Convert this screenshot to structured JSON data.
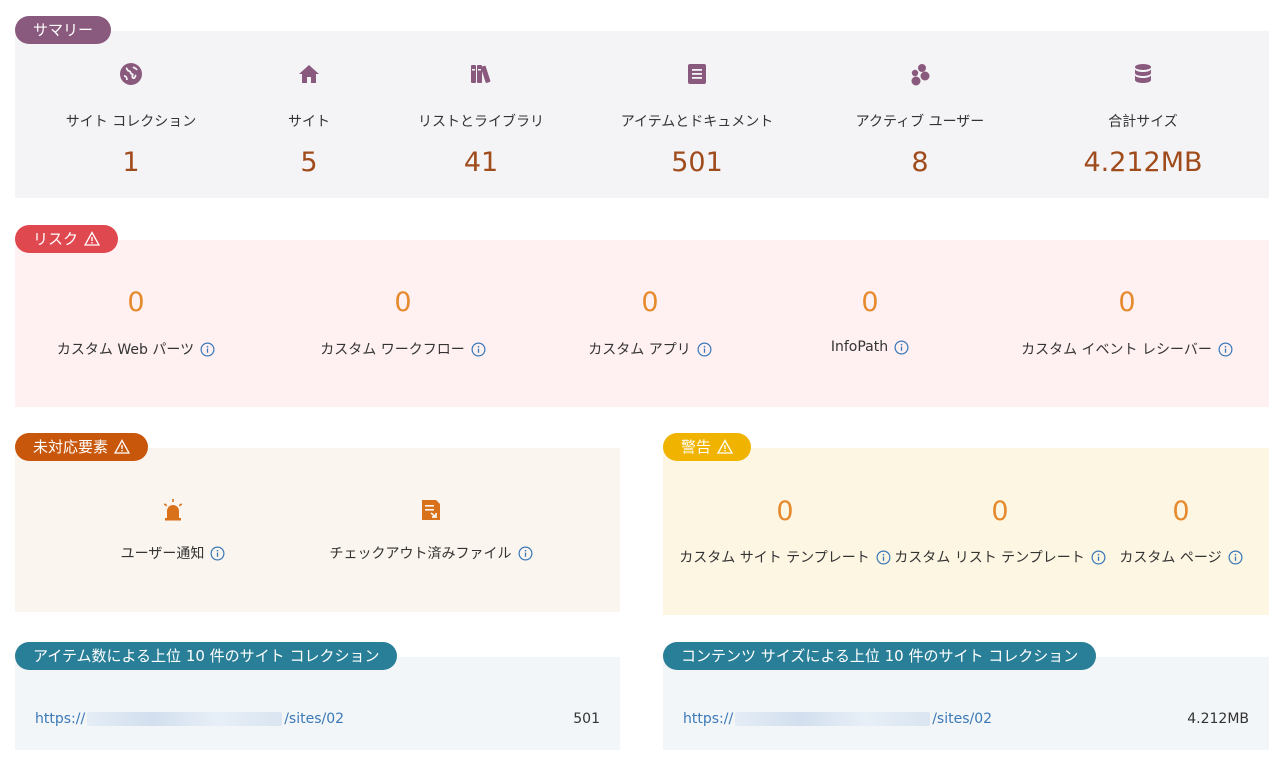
{
  "summary": {
    "tag": "サマリー",
    "items": [
      {
        "icon": "globe-icon",
        "label": "サイト コレクション",
        "value": "1"
      },
      {
        "icon": "home-icon",
        "label": "サイト",
        "value": "5"
      },
      {
        "icon": "library-books-icon",
        "label": "リストとライブラリ",
        "value": "41"
      },
      {
        "icon": "document-icon",
        "label": "アイテムとドキュメント",
        "value": "501"
      },
      {
        "icon": "users-icon",
        "label": "アクティブ ユーザー",
        "value": "8"
      },
      {
        "icon": "database-icon",
        "label": "合計サイズ",
        "value": "4.212MB"
      }
    ]
  },
  "risk": {
    "tag": "リスク",
    "items": [
      {
        "label": "カスタム Web パーツ",
        "value": "0"
      },
      {
        "label": "カスタム ワークフロー",
        "value": "0"
      },
      {
        "label": "カスタム アプリ",
        "value": "0"
      },
      {
        "label": "InfoPath",
        "value": "0"
      },
      {
        "label": "カスタム イベント レシーバー",
        "value": "0"
      }
    ]
  },
  "unsupported": {
    "tag": "未対応要素",
    "items": [
      {
        "icon": "alarm-icon",
        "label": "ユーザー通知"
      },
      {
        "icon": "checkout-file-icon",
        "label": "チェックアウト済みファイル"
      }
    ]
  },
  "warning": {
    "tag": "警告",
    "items": [
      {
        "label": "カスタム サイト テンプレート",
        "value": "0"
      },
      {
        "label": "カスタム リスト テンプレート",
        "value": "0"
      },
      {
        "label": "カスタム ページ",
        "value": "0"
      }
    ]
  },
  "top_items": {
    "tag": "アイテム数による上位 10 件のサイト コレクション",
    "url_prefix": "https://",
    "url_suffix": "/sites/02",
    "value": "501"
  },
  "top_size": {
    "tag": "コンテンツ サイズによる上位 10 件のサイト コレクション",
    "url_prefix": "https://",
    "url_suffix": "/sites/02",
    "value": "4.212MB"
  },
  "colors": {
    "summary_accent": "#8a5a7e",
    "risk_accent": "#e04850",
    "unsupported_accent": "#c8570c",
    "warning_accent": "#f0b400",
    "top_accent": "#2a7f98",
    "summary_value": "#a04b1c",
    "zero_value": "#e68a2e",
    "link": "#3b78b8"
  }
}
